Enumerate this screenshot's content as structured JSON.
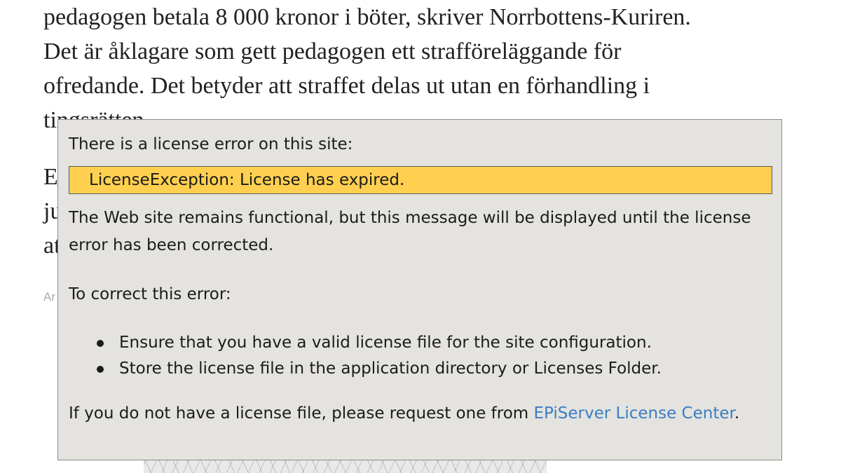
{
  "article": {
    "lines": [
      "pedagogen betala 8 000 kronor i böter, skriver Norrbottens-Kuriren.",
      "Det är åklagare som gett pedagogen ett strafföreläggande för",
      "ofredande. Det betyder att straffet delas ut utan en förhandling i",
      "tingsrätten.",
      "E",
      "ju",
      "at"
    ],
    "byline": "Ar"
  },
  "license_error": {
    "heading": "There is a license error on this site:",
    "error_message": "LicenseException: License has expired.",
    "description": "The Web site remains functional, but this message will be displayed until the license error has been corrected.",
    "correct_heading": "To correct this error:",
    "steps": [
      "Ensure that you have a valid license file for the site configuration.",
      "Store the license file in the application directory or Licenses Folder."
    ],
    "footer_prefix": "If you do not have a license file, please request one from ",
    "footer_link": "EPiServer License Center",
    "footer_suffix": "."
  },
  "colors": {
    "error_background": "#ffd04f",
    "box_background": "#e4e3df",
    "link": "#3b7dc4"
  }
}
